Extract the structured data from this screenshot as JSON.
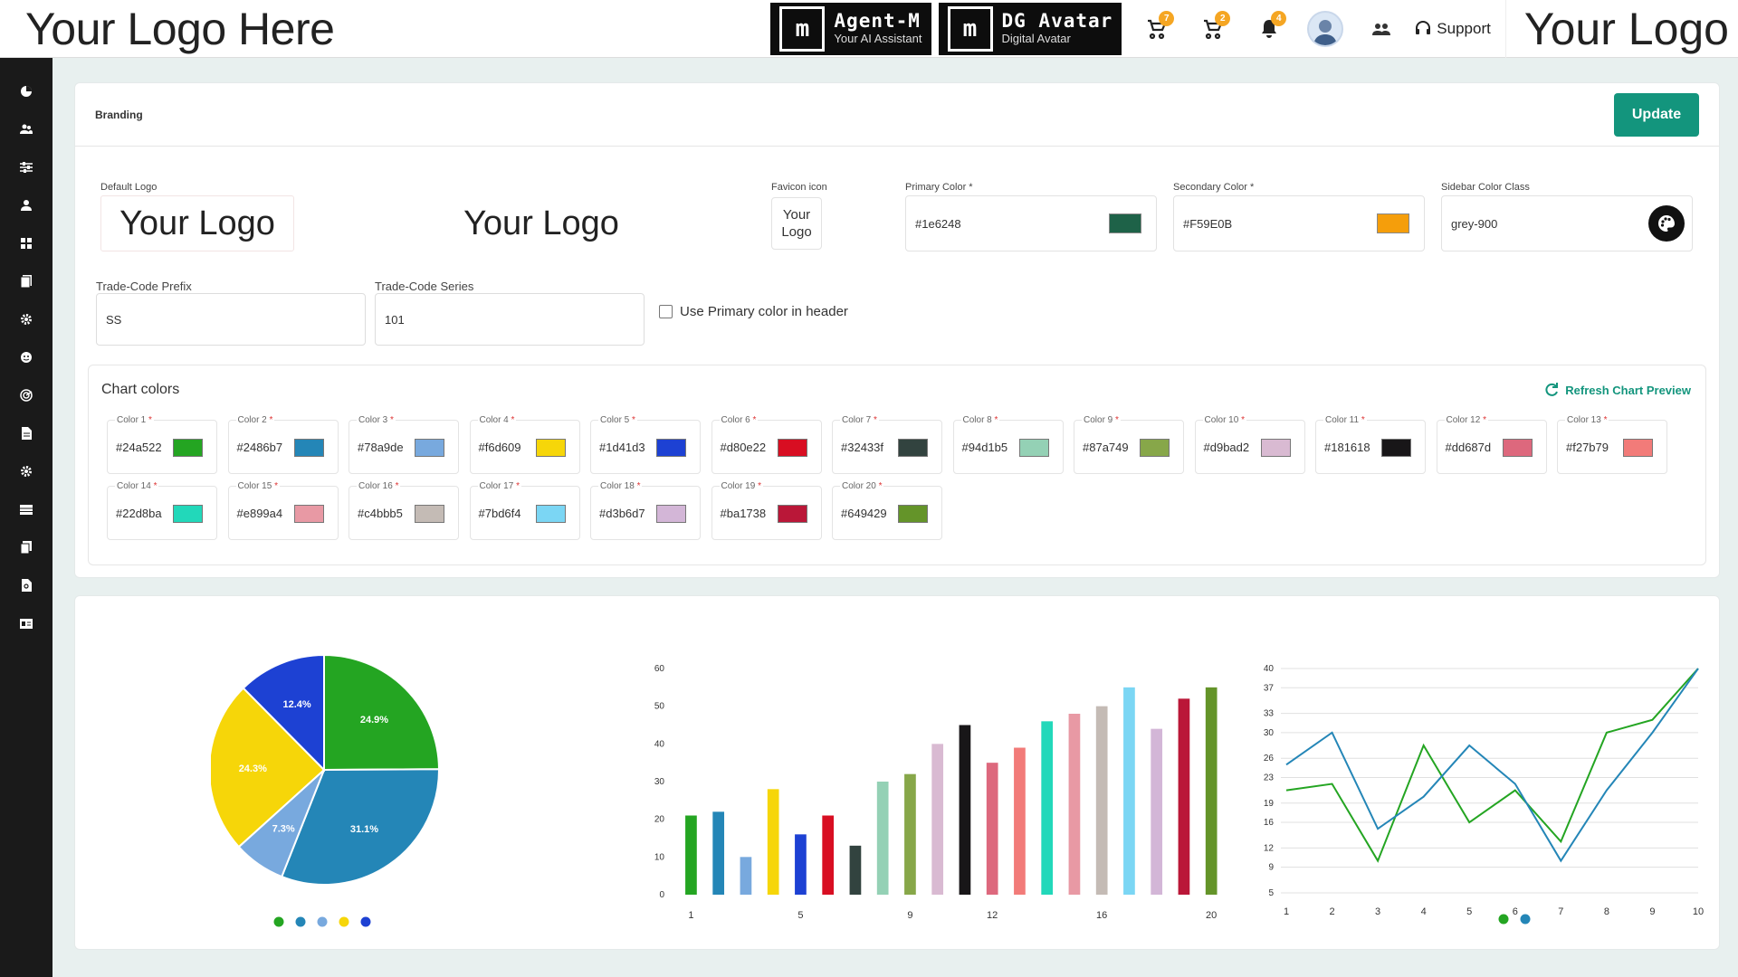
{
  "header": {
    "logo_text": "Your Logo Here",
    "logo_right_text": "Your Logo",
    "promos": [
      {
        "mark": "m",
        "title": "Agent-M",
        "subtitle": "Your AI Assistant"
      },
      {
        "mark": "m",
        "title": "DG Avatar",
        "subtitle": "Digital Avatar"
      }
    ],
    "cart_badge_1": "7",
    "cart_badge_2": "2",
    "notif_badge": "4",
    "support_label": "Support",
    "icons": [
      "cart-icon",
      "cart-icon",
      "bell-icon",
      "avatar",
      "users-icon",
      "headset-icon"
    ]
  },
  "sidebar": {
    "icons": [
      "pie-chart-icon",
      "users-icon",
      "sliders-icon",
      "user-icon",
      "grid-icon",
      "document-stack-icon",
      "gear-icon",
      "face-icon",
      "radar-icon",
      "file-icon",
      "gear-icon",
      "table-icon",
      "books-icon",
      "file-search-icon",
      "id-card-icon"
    ]
  },
  "branding": {
    "title": "Branding",
    "update_label": "Update",
    "default_logo_label": "Default Logo",
    "default_logo_text": "Your Logo",
    "alt_logo_text": "Your Logo",
    "favicon_label": "Favicon icon",
    "favicon_text_1": "Your",
    "favicon_text_2": "Logo",
    "primary_label": "Primary Color *",
    "primary_value": "#1e6248",
    "primary_color": "#1e6248",
    "secondary_label": "Secondary Color *",
    "secondary_value": "#F59E0B",
    "secondary_color": "#F59E0B",
    "sidebar_class_label": "Sidebar Color Class",
    "sidebar_class_value": "grey-900",
    "trade_prefix_label": "Trade-Code Prefix",
    "trade_prefix_value": "SS",
    "trade_series_label": "Trade-Code Series",
    "trade_series_value": "101",
    "primary_header_label": "Use Primary color in header",
    "primary_header_checked": false
  },
  "chart_colors": {
    "title": "Chart colors",
    "refresh_label": "Refresh Chart Preview",
    "items": [
      {
        "label": "Color 1",
        "value": "#24a522"
      },
      {
        "label": "Color 2",
        "value": "#2486b7"
      },
      {
        "label": "Color 3",
        "value": "#78a9de"
      },
      {
        "label": "Color 4",
        "value": "#f6d609"
      },
      {
        "label": "Color 5",
        "value": "#1d41d3"
      },
      {
        "label": "Color 6",
        "value": "#d80e22"
      },
      {
        "label": "Color 7",
        "value": "#32433f"
      },
      {
        "label": "Color 8",
        "value": "#94d1b5"
      },
      {
        "label": "Color 9",
        "value": "#87a749"
      },
      {
        "label": "Color 10",
        "value": "#d9bad2"
      },
      {
        "label": "Color 11",
        "value": "#181618"
      },
      {
        "label": "Color 12",
        "value": "#dd687d"
      },
      {
        "label": "Color 13",
        "value": "#f27b79"
      },
      {
        "label": "Color 14",
        "value": "#22d8ba"
      },
      {
        "label": "Color 15",
        "value": "#e899a4"
      },
      {
        "label": "Color 16",
        "value": "#c4bbb5"
      },
      {
        "label": "Color 17",
        "value": "#7bd6f4"
      },
      {
        "label": "Color 18",
        "value": "#d3b6d7"
      },
      {
        "label": "Color 19",
        "value": "#ba1738"
      },
      {
        "label": "Color 20",
        "value": "#649429"
      }
    ]
  },
  "chart_data": [
    {
      "type": "pie",
      "slices": [
        {
          "value": 24.9,
          "label": "24.9%",
          "color": "#24a522"
        },
        {
          "value": 31.1,
          "label": "31.1%",
          "color": "#2486b7"
        },
        {
          "value": 7.3,
          "label": "7.3%",
          "color": "#78a9de"
        },
        {
          "value": 24.3,
          "label": "24.3%",
          "color": "#f6d609"
        },
        {
          "value": 12.4,
          "label": "12.4%",
          "color": "#1d41d3"
        }
      ],
      "legend": "bottom"
    },
    {
      "type": "bar",
      "x": [
        1,
        2,
        3,
        4,
        5,
        6,
        7,
        8,
        9,
        10,
        11,
        12,
        13,
        14,
        15,
        16,
        17,
        18,
        19,
        20
      ],
      "values": [
        21,
        22,
        10,
        28,
        16,
        21,
        13,
        30,
        32,
        40,
        45,
        35,
        39,
        46,
        48,
        50,
        55,
        44,
        52,
        55
      ],
      "xticks": [
        "1",
        "5",
        "9",
        "12",
        "16",
        "20"
      ],
      "yticks": [
        "0",
        "10",
        "20",
        "30",
        "40",
        "50",
        "60"
      ],
      "ylim": [
        0,
        60
      ],
      "grid": false
    },
    {
      "type": "line",
      "x": [
        1,
        2,
        3,
        4,
        5,
        6,
        7,
        8,
        9,
        10
      ],
      "series": [
        {
          "values": [
            21,
            22,
            10,
            28,
            16,
            21,
            13,
            30,
            32,
            40
          ],
          "color": "#24a522"
        },
        {
          "values": [
            25,
            30,
            15,
            20,
            28,
            22,
            10,
            21,
            30,
            40
          ],
          "color": "#2486b7"
        }
      ],
      "yticks": [
        "5",
        "9",
        "12",
        "16",
        "19",
        "23",
        "26",
        "30",
        "33",
        "37",
        "40"
      ],
      "xticks": [
        "1",
        "2",
        "3",
        "4",
        "5",
        "6",
        "7",
        "8",
        "9",
        "10"
      ],
      "ylim": [
        5,
        40
      ],
      "grid": true,
      "legend": "bottom"
    }
  ]
}
